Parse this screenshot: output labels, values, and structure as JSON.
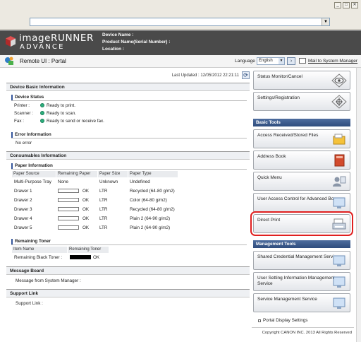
{
  "browser": {
    "window_buttons": [
      "_",
      "□",
      "✕"
    ],
    "address_value": ""
  },
  "header": {
    "brand": "imageRUNNER",
    "brand_sub": "ADVANCE",
    "device_name_label": "Device Name :",
    "product_name_label": "Product Name(Serial Number) :",
    "location_label": "Location :"
  },
  "portal": {
    "title": "Remote UI : Portal",
    "language_label": "Language",
    "language_value": "English",
    "mail_link": "Mail to System Manager"
  },
  "main": {
    "last_updated": "Last Updated : 12/05/2012 22:21:11",
    "device_basic_info": "Device Basic Information",
    "device_status": {
      "title": "Device Status",
      "rows": [
        {
          "label": "Printer :",
          "status": "Ready to print."
        },
        {
          "label": "Scanner :",
          "status": "Ready to scan."
        },
        {
          "label": "Fax :",
          "status": "Ready to send or receive fax."
        }
      ]
    },
    "error_info": {
      "title": "Error Information",
      "text": "No error"
    },
    "consumables_info": "Consumables Information",
    "paper_info": {
      "title": "Paper Information",
      "headers": [
        "Paper Source",
        "Remaining Paper",
        "Paper Size",
        "Paper Type"
      ],
      "rows": [
        {
          "source": "Multi-Purpose Tray",
          "remaining": "None",
          "size": "Unknown",
          "type": "Undefined"
        },
        {
          "source": "Drawer 1",
          "remaining": "OK",
          "size": "LTR",
          "type": "Recycled (64-80 g/m2)"
        },
        {
          "source": "Drawer 2",
          "remaining": "OK",
          "size": "LTR",
          "type": "Color (64-80 g/m2)"
        },
        {
          "source": "Drawer 3",
          "remaining": "OK",
          "size": "LTR",
          "type": "Recycled (64-80 g/m2)"
        },
        {
          "source": "Drawer 4",
          "remaining": "OK",
          "size": "LTR",
          "type": "Plain 2 (64-90 g/m2)"
        },
        {
          "source": "Drawer 5",
          "remaining": "OK",
          "size": "LTR",
          "type": "Plain 2 (64-90 g/m2)"
        }
      ]
    },
    "remaining_toner": {
      "title": "Remaining Toner",
      "headers": [
        "Item Name",
        "Remaining Toner"
      ],
      "row": {
        "name": "Remaining Black Toner :",
        "value": "OK"
      }
    },
    "message_board": {
      "title": "Message Board",
      "text": "Message from System Manager :"
    },
    "support_link": {
      "title": "Support Link",
      "text": "Support Link :"
    }
  },
  "side": {
    "status_monitor": "Status Monitor/Cancel",
    "settings_registration": "Settings/Registration",
    "basic_tools_title": "Basic Tools",
    "basic_tools": [
      "Access Received/Stored Files",
      "Address Book",
      "Quick Menu",
      "User Access Control for Advanced Box",
      "Direct Print"
    ],
    "management_tools_title": "Management Tools",
    "management_tools": [
      "Shared Credential Management Service",
      "User Setting Information Management Service",
      "Service Management Service"
    ],
    "portal_display_settings": "Portal Display Settings",
    "copyright": "Copyright CANON INC. 2013 All Rights Reserved"
  }
}
